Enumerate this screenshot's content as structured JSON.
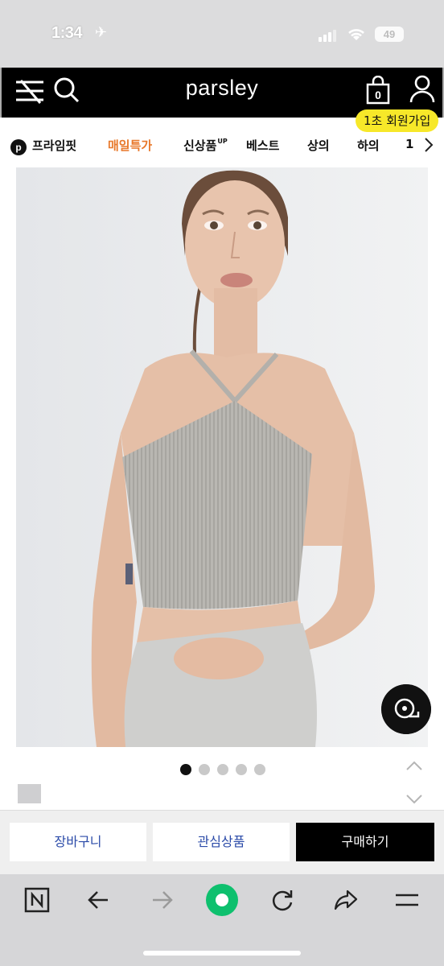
{
  "status": {
    "time": "1:34",
    "battery": "49"
  },
  "header": {
    "logo": "parsley",
    "cart_count": "0",
    "signup_badge": "1초 회원가입"
  },
  "categories": {
    "prime": "프라임핏",
    "sale": "매일특가",
    "new": "신상품",
    "new_sup": "UP",
    "best": "베스트",
    "top": "상의",
    "bottom": "하의",
    "more": "1"
  },
  "gallery": {
    "dot_count": 5,
    "active_index": 0
  },
  "actions": {
    "cart": "장바구니",
    "wish": "관심상품",
    "buy": "구매하기"
  },
  "colors": {
    "accent_sale": "#e8792b",
    "badge": "#f7e829",
    "button_text": "#2a4aa8",
    "browser_green": "#0ec06e"
  },
  "icons": {
    "menu": "menu-close-icon",
    "search": "search-icon",
    "cart": "shopping-bag-icon",
    "user": "user-icon",
    "size": "tape-measure-icon",
    "naver": "naver-n-icon",
    "back": "arrow-left-icon",
    "forward": "arrow-right-icon",
    "home": "green-dot-icon",
    "reload": "reload-icon",
    "share": "share-icon",
    "more": "hamburger-icon"
  }
}
